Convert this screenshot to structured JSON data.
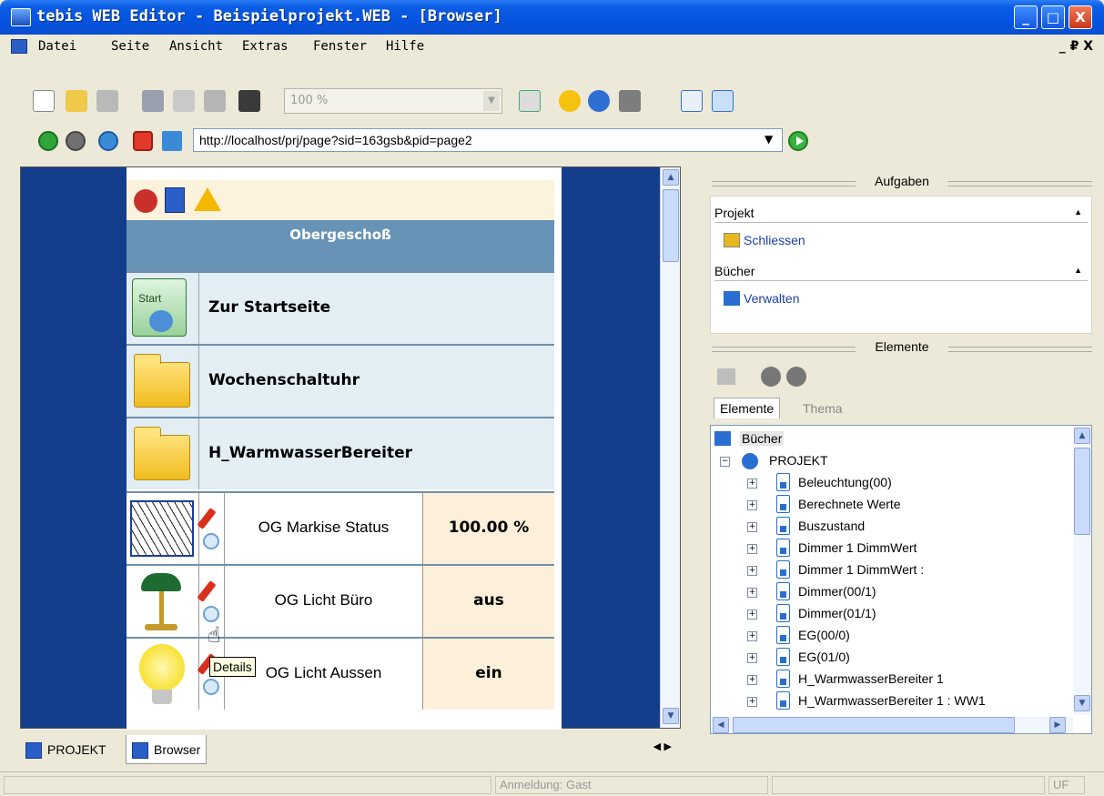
{
  "window": {
    "title": "tebis  WEB Editor - Beispielprojekt.WEB - [Browser]",
    "minimize": "_",
    "maximize": "□",
    "close": "X"
  },
  "menu": {
    "items": [
      "Datei",
      "Seite",
      "Ansicht",
      "Extras",
      "Fenster",
      "Hilfe"
    ],
    "mdi_controls": "_ ₽ X"
  },
  "toolbar": {
    "zoom_value": "100 %"
  },
  "address": {
    "url": "http://localhost/prj/page?sid=163gsb&pid=page2"
  },
  "page": {
    "heading": "Obergeschoß",
    "nav_rows": [
      "Zur Startseite",
      "Wochenschaltuhr",
      "H_WarmwasserBereiter"
    ],
    "start_icon_text": "Start",
    "data_rows": [
      {
        "label": "OG Markise Status",
        "value": "100.00 %"
      },
      {
        "label": "OG Licht Büro",
        "value": "aus"
      },
      {
        "label": "OG Licht Aussen",
        "value": "ein"
      }
    ],
    "tooltip": "Details"
  },
  "bottom_tabs": {
    "projekt": "PROJEKT",
    "browser": "Browser"
  },
  "right": {
    "aufgaben_title": "Aufgaben",
    "group_projekt": "Projekt",
    "link_schliessen": "Schliessen",
    "group_buecher": "Bücher",
    "link_verwalten": "Verwalten",
    "elemente_title": "Elemente",
    "tab_elemente": "Elemente",
    "tab_thema": "Thema",
    "tree_root": "Bücher",
    "tree_project": "PROJEKT",
    "tree_items": [
      "Beleuchtung(00)",
      "Berechnete Werte",
      "Buszustand",
      "Dimmer 1 DimmWert",
      "Dimmer 1 DimmWert :",
      "Dimmer(00/1)",
      "Dimmer(01/1)",
      "EG(00/0)",
      "EG(01/0)",
      "H_WarmwasserBereiter 1",
      "H_WarmwasserBereiter 1 : WW1"
    ]
  },
  "status": {
    "login": "Anmeldung: Gast",
    "mode": "UF"
  },
  "colors": {
    "title_blue": "#0554e0",
    "heading_blue": "#6794b6",
    "page_bg": "#143e8c",
    "link": "#1a3fa8"
  }
}
